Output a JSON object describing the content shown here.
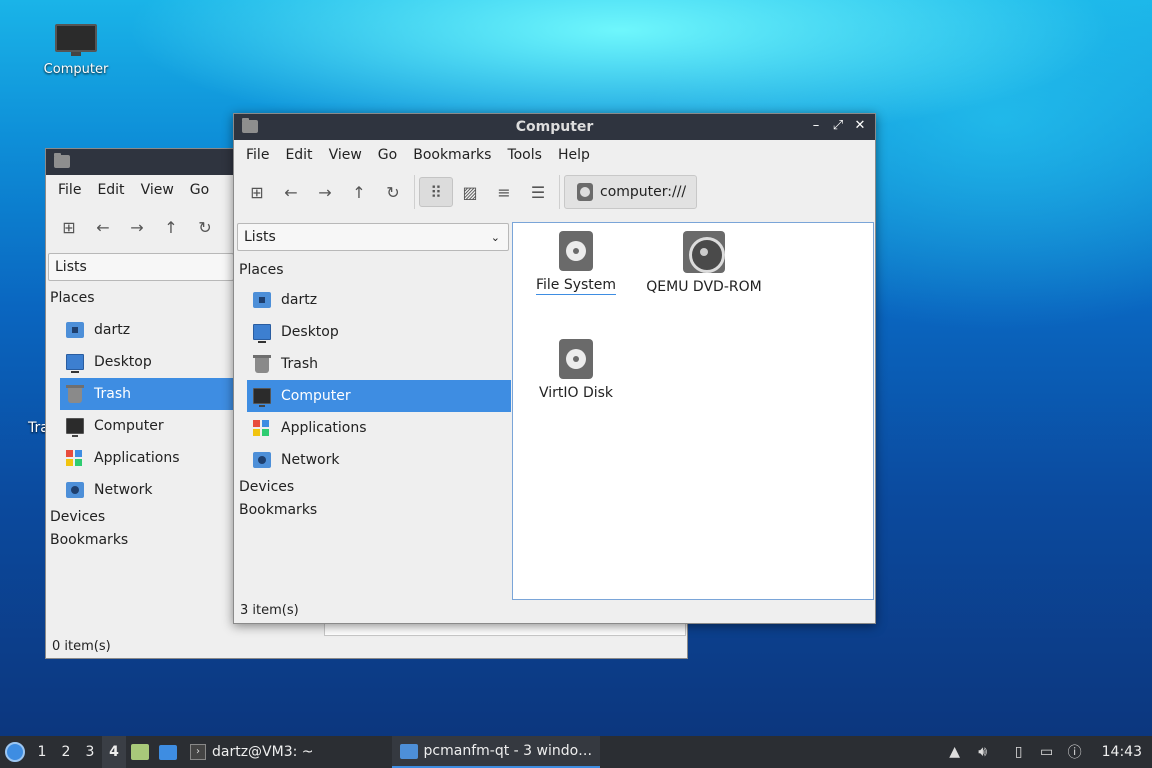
{
  "desktop": {
    "computer_label": "Computer",
    "trash_partial": "Tra"
  },
  "back_window": {
    "menu": [
      "File",
      "Edit",
      "View",
      "Go"
    ],
    "side_combo": "Lists",
    "places_header": "Places",
    "places": [
      "dartz",
      "Desktop",
      "Trash",
      "Computer",
      "Applications",
      "Network"
    ],
    "devices_header": "Devices",
    "bookmarks_header": "Bookmarks",
    "status": "0 item(s)"
  },
  "front_window": {
    "title": "Computer",
    "menu": [
      "File",
      "Edit",
      "View",
      "Go",
      "Bookmarks",
      "Tools",
      "Help"
    ],
    "address": "computer:///",
    "side_combo": "Lists",
    "places_header": "Places",
    "places": [
      "dartz",
      "Desktop",
      "Trash",
      "Computer",
      "Applications",
      "Network"
    ],
    "devices_header": "Devices",
    "bookmarks_header": "Bookmarks",
    "files": [
      "File System",
      "QEMU DVD-ROM",
      "VirtIO Disk"
    ],
    "status": "3 item(s)"
  },
  "taskbar": {
    "workspaces": [
      "1",
      "2",
      "3",
      "4"
    ],
    "terminal_task": "dartz@VM3: ~",
    "files_task": "pcmanfm-qt - 3 windo…",
    "clock": "14:43"
  },
  "colors": {
    "selection": "#3e8de2",
    "titlebar": "#2f343f",
    "taskbar": "#2b2e33"
  }
}
